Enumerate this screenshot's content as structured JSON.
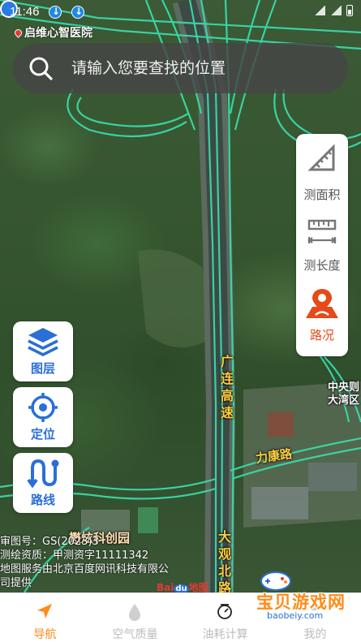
{
  "status_bar": {
    "time": "11:46"
  },
  "map": {
    "poi_top": "启维心智医院",
    "road_labels": {
      "expressway_upper": "广连高速",
      "expressway_lower": "大观北路",
      "street": "力康路"
    },
    "place_labels": {
      "park": "懋炫科创园",
      "center_line1": "中央则",
      "center_line2": "大湾区"
    }
  },
  "search": {
    "placeholder": "请输入您要查找的位置"
  },
  "tools": [
    {
      "label": "测面积",
      "icon": "ruler-area-icon"
    },
    {
      "label": "测长度",
      "icon": "ruler-length-icon"
    },
    {
      "label": "路况",
      "icon": "traffic-icon",
      "active": true
    }
  ],
  "left_buttons": [
    {
      "label": "图层",
      "icon": "layers-icon"
    },
    {
      "label": "定位",
      "icon": "locate-icon"
    },
    {
      "label": "路线",
      "icon": "route-icon"
    }
  ],
  "copyright": {
    "line1": "审图号：GS(2023)3",
    "line2": "测绘资质：甲测资字11111342",
    "line3": "地图服务由北京百度网讯科技有限公",
    "line4": "司提供",
    "logo": "Bai",
    "logo_du": "du",
    "logo_suffix": "地图"
  },
  "watermark": {
    "title": "宝贝游戏网",
    "url": "baobeiy.com"
  },
  "bottom_nav": [
    {
      "label": "导航",
      "icon": "navigation-icon",
      "active": true
    },
    {
      "label": "空气质量",
      "icon": "air-quality-icon"
    },
    {
      "label": "油耗计算",
      "icon": "fuel-calc-icon"
    },
    {
      "label": "我的",
      "icon": "profile-icon"
    }
  ],
  "colors": {
    "accent_blue": "#2a6fd6",
    "active_orange": "#ff8c1a",
    "traffic_red": "#e64a19",
    "road_glow": "#39d9a8",
    "road_label": "#ffcf3f"
  }
}
